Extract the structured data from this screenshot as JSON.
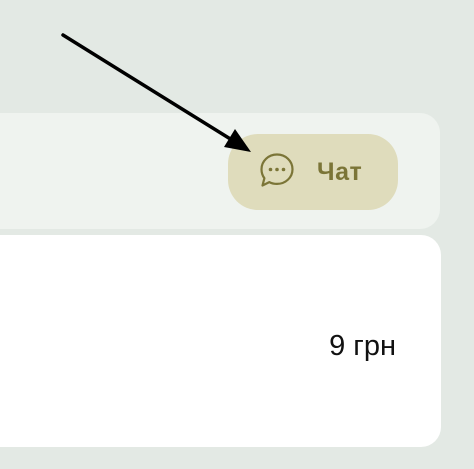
{
  "chat_button": {
    "label": "Чат",
    "icon": "chat-bubble-dots-icon"
  },
  "item": {
    "price": "9 грн"
  },
  "annotation": {
    "icon": "arrow-pointer-icon"
  },
  "colors": {
    "background": "#e3e9e4",
    "header_panel": "#eff3ef",
    "chat_button_bg": "#dfdcbc",
    "chat_accent": "#7b7537",
    "card": "#ffffff",
    "text": "#111111"
  }
}
